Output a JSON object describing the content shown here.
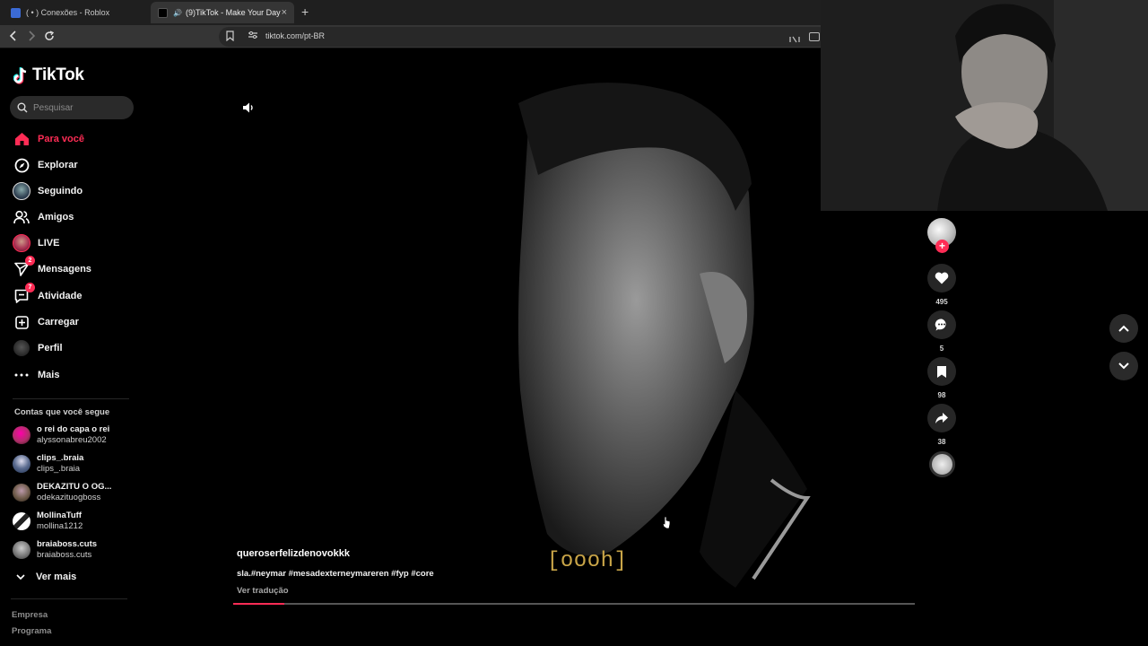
{
  "browser": {
    "tabs": [
      {
        "title": "( • ) Conexões - Roblox"
      },
      {
        "title": "(9)TikTok - Make Your Day",
        "close": "×"
      }
    ],
    "new_tab": "+",
    "url": "tiktok.com/pt-BR"
  },
  "sidebar": {
    "logo": "TikTok",
    "search_placeholder": "Pesquisar",
    "nav": [
      {
        "label": "Para você",
        "icon": "home-icon",
        "active": true
      },
      {
        "label": "Explorar",
        "icon": "compass-icon"
      },
      {
        "label": "Seguindo",
        "icon": "following-avatar-icon"
      },
      {
        "label": "Amigos",
        "icon": "friends-icon"
      },
      {
        "label": "LIVE",
        "icon": "live-avatar-icon"
      },
      {
        "label": "Mensagens",
        "icon": "send-icon",
        "badge": "2"
      },
      {
        "label": "Atividade",
        "icon": "inbox-icon",
        "badge": "7"
      },
      {
        "label": "Carregar",
        "icon": "upload-icon"
      },
      {
        "label": "Perfil",
        "icon": "profile-avatar-icon"
      },
      {
        "label": "Mais",
        "icon": "more-icon"
      }
    ],
    "following_title": "Contas que você segue",
    "following": [
      {
        "name": "o rei do capa o rei",
        "handle": "alyssonabreu2002",
        "color": "#b0306a"
      },
      {
        "name": "clips_.braia",
        "handle": "clips_.braia",
        "color": "#5a6b8f"
      },
      {
        "name": "DEKAZITU O OG...",
        "handle": "odekazituogboss",
        "color": "#6e5b4a"
      },
      {
        "name": "MollinaTuff",
        "handle": "mollina1212",
        "color": "#d8d8d8"
      },
      {
        "name": "braiaboss.cuts",
        "handle": "braiaboss.cuts",
        "color": "#7a7a7a"
      }
    ],
    "see_more": "Ver mais",
    "footer": [
      "Empresa",
      "Programa"
    ]
  },
  "video": {
    "caption_tag": "[oooh]",
    "username": "queroserfelizdenovokkk",
    "description": "sla.#neymar #mesadexterneymareren #fyp #core",
    "translate": "Ver tradução",
    "progress": 0.075
  },
  "actions": {
    "likes": "495",
    "comments": "5",
    "saves": "98",
    "shares": "38"
  },
  "colors": {
    "accent": "#fe2c55",
    "background": "#000000",
    "caption": "#c9a548"
  }
}
